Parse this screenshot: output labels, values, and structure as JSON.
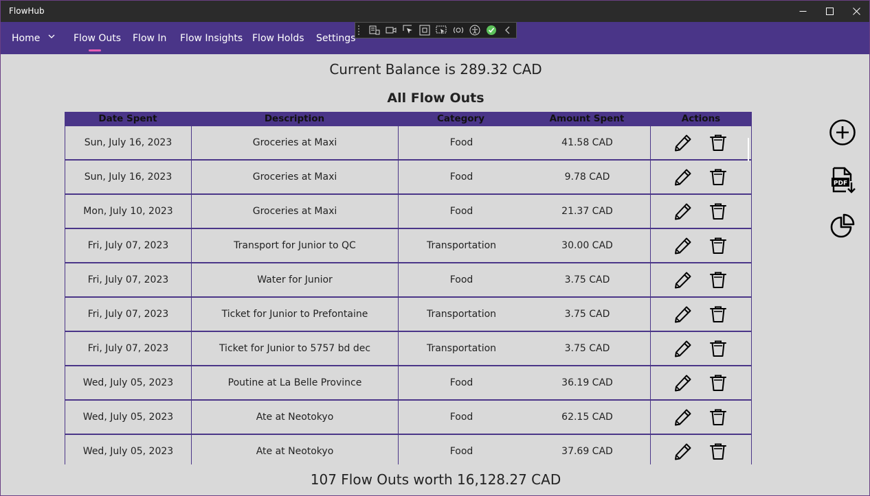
{
  "window": {
    "title": "FlowHub"
  },
  "nav": {
    "home": "Home",
    "flow_outs": "Flow Outs",
    "flow_in": "Flow In",
    "flow_insights": "Flow Insights",
    "flow_holds": "Flow Holds",
    "settings": "Settings"
  },
  "balance_text": "Current Balance is 289.32 CAD",
  "section_title": "All Flow Outs",
  "table": {
    "headers": [
      "Date Spent",
      "Description",
      "Category",
      "Amount Spent",
      "Actions"
    ],
    "rows": [
      {
        "date": "Sun, July 16, 2023",
        "description": "Groceries at Maxi",
        "category": "Food",
        "amount": "41.58 CAD"
      },
      {
        "date": "Sun, July 16, 2023",
        "description": "Groceries at Maxi",
        "category": "Food",
        "amount": "9.78 CAD"
      },
      {
        "date": "Mon, July 10, 2023",
        "description": "Groceries at Maxi",
        "category": "Food",
        "amount": "21.37 CAD"
      },
      {
        "date": "Fri, July 07, 2023",
        "description": "Transport for Junior to QC",
        "category": "Transportation",
        "amount": "30.00 CAD"
      },
      {
        "date": "Fri, July 07, 2023",
        "description": "Water for Junior",
        "category": "Food",
        "amount": "3.75 CAD"
      },
      {
        "date": "Fri, July 07, 2023",
        "description": "Ticket for Junior to Prefontaine",
        "category": "Transportation",
        "amount": "3.75 CAD"
      },
      {
        "date": "Fri, July 07, 2023",
        "description": "Ticket for Junior to 5757 bd dec",
        "category": "Transportation",
        "amount": "3.75 CAD"
      },
      {
        "date": "Wed, July 05, 2023",
        "description": "Poutine at La Belle Province",
        "category": "Food",
        "amount": "36.19 CAD"
      },
      {
        "date": "Wed, July 05, 2023",
        "description": "Ate at Neotokyo",
        "category": "Food",
        "amount": "62.15 CAD"
      },
      {
        "date": "Wed, July 05, 2023",
        "description": "Ate at Neotokyo",
        "category": "Food",
        "amount": "37.69 CAD"
      }
    ]
  },
  "footer_text": "107 Flow Outs worth 16,128.27 CAD",
  "colors": {
    "accent": "#4a3588",
    "active_indicator": "#e75fb4",
    "titlebar": "#2b2b2b",
    "background": "#d9d9d9"
  },
  "icons": [
    "edit-pencil-icon",
    "delete-trash-icon",
    "add-circle-icon",
    "export-pdf-icon",
    "pie-chart-icon"
  ]
}
